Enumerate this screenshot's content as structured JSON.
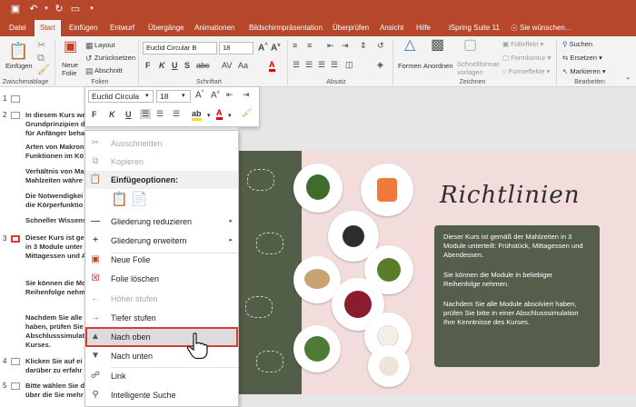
{
  "titlebar": {
    "qa_icons": [
      "save-icon",
      "undo-icon",
      "redo-icon",
      "present-icon",
      "customize-icon"
    ]
  },
  "tabs": [
    "Datei",
    "Start",
    "Einfügen",
    "Entwurf",
    "Übergänge",
    "Animationen",
    "Bildschirmpräsentation",
    "Überprüfen",
    "Ansicht",
    "Hilfe",
    "iSpring Suite 11",
    "Sie wünschen..."
  ],
  "active_tab": "Start",
  "ribbon": {
    "paste": "Einfügen",
    "new_slide": "Neue Folie",
    "layout": "Layout",
    "reset": "Zurücksetzen",
    "section": "Abschnitt",
    "font_name": "Euclid Circular B",
    "font_size": "18",
    "shapes": "Formen",
    "arrange": "Anordnen",
    "quick_styles": "Schnellformat-vorlagen",
    "fill": "Fülleffekt",
    "outline": "Formkontur",
    "effects": "Formeffekte",
    "find": "Suchen",
    "replace": "Ersetzen",
    "select": "Markieren",
    "groups": [
      "Zwischenablage",
      "Folien",
      "Schriftart",
      "Absatz",
      "Zeichnen",
      "Bearbeiten"
    ],
    "colors": {
      "accent": "#b7472a"
    }
  },
  "outline": {
    "slide_numbers": [
      "1",
      "2",
      "3",
      "4",
      "5"
    ],
    "blocks": [
      "In diesem Kurs we\nGrundprinzipien d\nfür Anfänger behandelt:",
      "Arten von Makron\nFunktionen im Kö",
      "Verhältnis von Ma\nMahlzeiten währe",
      "Die Notwendigkei\ndie Körperfunktio",
      "Schneller Wissens",
      "Dieser Kurs ist ge\nin 3 Module unter\nMittagessen und A",
      "Sie können die Mo\nReihenfolge nehm",
      "Nachdem Sie alle\nhaben, prüfen Sie\nAbschlusssimulati\nKurses.",
      "Klicken Sie auf ei\ndarüber zu erfahr",
      "Bitte wählen Sie d\nüber die Sie mehr"
    ]
  },
  "minitoolbar": {
    "font": "Euclid Circula",
    "size": "18",
    "btns": [
      "F",
      "K",
      "U"
    ]
  },
  "context_menu": {
    "items": [
      {
        "label": "Ausschneiden",
        "icon": "scissors-icon",
        "enabled": false
      },
      {
        "label": "Kopieren",
        "icon": "copy-icon",
        "enabled": false
      },
      {
        "label": "Einfügeoptionen:",
        "icon": "paste-icon",
        "enabled": true
      },
      {
        "label": "Gliederung reduzieren",
        "icon": "minus-icon",
        "enabled": true
      },
      {
        "label": "Gliederung erweitern",
        "icon": "plus-icon",
        "enabled": true
      },
      {
        "label": "Neue Folie",
        "icon": "new-slide-icon",
        "enabled": true
      },
      {
        "label": "Folie löschen",
        "icon": "delete-slide-icon",
        "enabled": true
      },
      {
        "label": "Höher stufen",
        "icon": "arrow-left-icon",
        "enabled": false
      },
      {
        "label": "Tiefer stufen",
        "icon": "arrow-right-icon",
        "enabled": true
      },
      {
        "label": "Nach oben",
        "icon": "triangle-up-icon",
        "enabled": true
      },
      {
        "label": "Nach unten",
        "icon": "triangle-down-icon",
        "enabled": true
      },
      {
        "label": "Link",
        "icon": "link-icon",
        "enabled": true
      },
      {
        "label": "Intelligente Suche",
        "icon": "search-icon",
        "enabled": true
      }
    ]
  },
  "slide": {
    "title": "Richtlinien",
    "paragraphs": [
      "Dieser Kurs ist gemäß der Mahlzeiten in 3 Module unterteilt: Frühstück, Mittagessen und Abendessen.",
      "Sie können die Module in beliebiger Reihenfolge nehmen.",
      "Nachdem Sie alle Module absolviert haben, prüfen Sie bitte in einer Abschlusssimulation Ihre Kenntnisse des Kurses."
    ]
  }
}
